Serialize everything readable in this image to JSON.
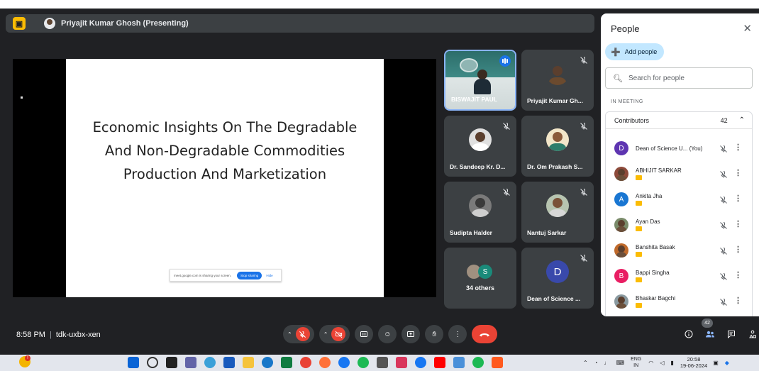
{
  "presenting": {
    "label": "Priyajit Kumar Ghosh (Presenting)"
  },
  "slide": {
    "title": "Economic Insights On The Degradable And Non-Degradable Commodities Production And Marketization",
    "share_bar": {
      "message": "meet.google.com is sharing your screen.",
      "stop_label": "Stop sharing",
      "hide_label": "Hide"
    }
  },
  "tiles": [
    {
      "name": "BISWAJIT PAUL",
      "speaking": true
    },
    {
      "name": "Priyajit Kumar Gh...",
      "muted": true
    },
    {
      "name": "Dr. Sandeep Kr. D...",
      "muted": true
    },
    {
      "name": "Dr. Om Prakash S...",
      "muted": true
    },
    {
      "name": "Sudipta Halder",
      "muted": true
    },
    {
      "name": "Nantuj Sarkar",
      "muted": true
    },
    {
      "name": "34 others",
      "avatar_letter": "S"
    },
    {
      "name": "Dean of Science ...",
      "muted": true,
      "avatar_letter": "D"
    }
  ],
  "people_panel": {
    "title": "People",
    "add_people_label": "Add people",
    "search_placeholder": "Search for people",
    "section_label": "IN MEETING",
    "group": {
      "label": "Contributors",
      "count": "42"
    },
    "participants": [
      {
        "name": "Dean of Science U... (You)",
        "letter": "D",
        "color": "#5e35b1",
        "badge": false
      },
      {
        "name": "ABHIJIT SARKAR",
        "color": "#8d4a3a",
        "badge": true
      },
      {
        "name": "Ankita Jha",
        "letter": "A",
        "color": "#1976d2",
        "badge": true
      },
      {
        "name": "Ayan Das",
        "color": "#7a8b6a",
        "badge": true
      },
      {
        "name": "Banshita Basak",
        "color": "#c06a2b",
        "badge": true
      },
      {
        "name": "Bappi Singha",
        "letter": "B",
        "color": "#e91e63",
        "badge": true
      },
      {
        "name": "Bhaskar Bagchi",
        "color": "#8a9aa0",
        "badge": true
      }
    ]
  },
  "bottom_bar": {
    "time": "8:58 PM",
    "meeting_code": "tdk-uxbx-xen",
    "people_count": "42"
  },
  "taskbar": {
    "lang_line1": "ENG",
    "lang_line2": "IN",
    "time": "20:58",
    "date": "19-06-2024"
  }
}
